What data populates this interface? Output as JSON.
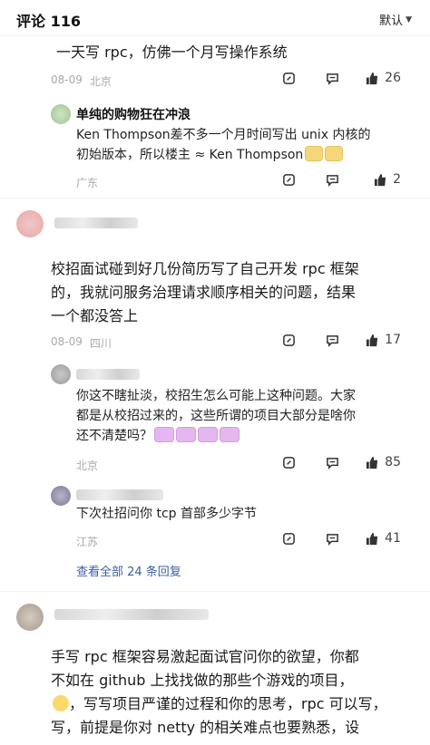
{
  "header": {
    "title": "评论 116",
    "sort": "默认"
  },
  "comments": [
    {
      "text": "一天写 rpc，仿佛一个月写操作系统",
      "date": "08-09",
      "location": "北京",
      "likes": "26",
      "replies": [
        {
          "author": "单纯的购物狂在冲浪",
          "text_line1": "Ken Thompson差不多一个月时间写出 unix 内核的",
          "text_line2": "初始版本，所以楼主 ≈ Ken Thompson",
          "location": "广东",
          "likes": "2"
        }
      ]
    },
    {
      "text_line1": "校招面试碰到好几份简历写了自己开发 rpc 框架",
      "text_line2": "的，我就问服务治理请求顺序相关的问题，结果",
      "text_line3": "一个都没答上",
      "date": "08-09",
      "location": "四川",
      "likes": "17",
      "replies": [
        {
          "text_line1": "你这不瞎扯淡，校招生怎么可能上这种问题。大家",
          "text_line2": "都是从校招过来的，这些所谓的项目大部分是啥你",
          "text_line3": "还不清楚吗？",
          "location": "北京",
          "likes": "85"
        },
        {
          "text": "下次社招问你 tcp 首部多少字节",
          "location": "江苏",
          "likes": "41"
        }
      ],
      "view_all": "查看全部 24 条回复"
    },
    {
      "text_line1": "手写 rpc 框架容易激起面试官问你的欲望，你都",
      "text_line2": "不如在 github 上找找做的那些个游戏的项目，",
      "text_line3": "，写写项目严谨的过程和你的思考，rpc 可以写，",
      "text_line4": "写，前提是你对 netty 的相关难点也要熟悉，设"
    }
  ],
  "colors": {
    "meta": "#aaaaaa",
    "link": "#3b5fa8",
    "text": "#1a1a1a"
  }
}
